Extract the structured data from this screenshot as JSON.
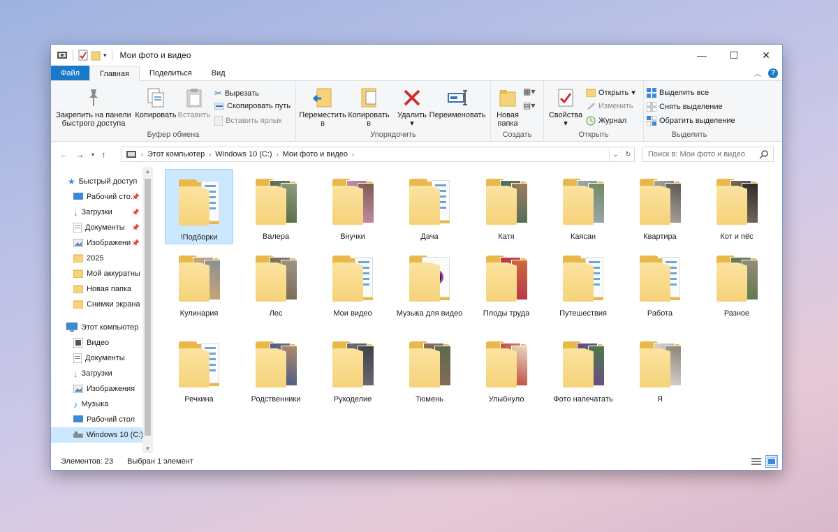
{
  "window": {
    "title": "Мои фото и видео",
    "controls": {
      "minimize": "—",
      "maximize": "☐",
      "close": "✕"
    }
  },
  "tabs": [
    "Файл",
    "Главная",
    "Поделиться",
    "Вид"
  ],
  "ribbon": {
    "clipboard": {
      "label": "Буфер обмена",
      "pin": "Закрепить на панели быстрого доступа",
      "pin_l1": "Закрепить на панели",
      "pin_l2": "быстрого доступа",
      "copy": "Копировать",
      "paste": "Вставить",
      "cut": "Вырезать",
      "copy_path": "Скопировать путь",
      "paste_shortcut": "Вставить ярлык"
    },
    "organize": {
      "label": "Упорядочить",
      "move_l1": "Переместить",
      "move_l2": "в",
      "copyto_l1": "Копировать",
      "copyto_l2": "в",
      "delete": "Удалить",
      "rename": "Переименовать"
    },
    "new": {
      "label": "Создать",
      "new_folder_l1": "Новая",
      "new_folder_l2": "папка"
    },
    "open": {
      "label": "Открыть",
      "properties": "Свойства",
      "open": "Открыть",
      "edit": "Изменить",
      "history": "Журнал"
    },
    "select": {
      "label": "Выделить",
      "select_all": "Выделить все",
      "select_none": "Снять выделение",
      "invert": "Обратить выделение"
    }
  },
  "address": {
    "crumbs": [
      "Этот компьютер",
      "Windows 10 (C:)",
      "Мои фото и видео"
    ],
    "search_placeholder": "Поиск в: Мои фото и видео"
  },
  "nav": {
    "quick_access": "Быстрый доступ",
    "quick_items": [
      "Рабочий сто...",
      "Загрузки",
      "Документы",
      "Изображени",
      "2025",
      "Мой аккуратны",
      "Новая папка",
      "Снимки экрана"
    ],
    "this_pc": "Этот компьютер",
    "pc_items": [
      "Видео",
      "Документы",
      "Загрузки",
      "Изображения",
      "Музыка",
      "Рабочий стол",
      "Windows 10 (C:)"
    ]
  },
  "folders": [
    {
      "name": "!Подборки",
      "kind": "paper",
      "selected": true
    },
    {
      "name": "Валера",
      "kind": "photo",
      "colors": [
        "#5a6b4a",
        "#8c9d7a"
      ]
    },
    {
      "name": "Внучки",
      "kind": "photo",
      "colors": [
        "#c98ca8",
        "#7a5b4e"
      ]
    },
    {
      "name": "Дача",
      "kind": "paper"
    },
    {
      "name": "Катя",
      "kind": "photo",
      "colors": [
        "#4d6e5a",
        "#a07b5c"
      ]
    },
    {
      "name": "Каясан",
      "kind": "photo",
      "colors": [
        "#9aa8b4",
        "#6f8a5e"
      ]
    },
    {
      "name": "Квартира",
      "kind": "photo",
      "colors": [
        "#a8a49c",
        "#5d5a56"
      ]
    },
    {
      "name": "Кот и пёс",
      "kind": "photo",
      "colors": [
        "#7a6a5a",
        "#2e2a28"
      ]
    },
    {
      "name": "Кулинария",
      "kind": "photo",
      "colors": [
        "#c9a874",
        "#8a8e94"
      ]
    },
    {
      "name": "Лес",
      "kind": "photo",
      "colors": [
        "#7a6a54",
        "#9e9484"
      ]
    },
    {
      "name": "Мои видео",
      "kind": "paper"
    },
    {
      "name": "Музыка для видео",
      "kind": "music"
    },
    {
      "name": "Плоды труда",
      "kind": "photo",
      "colors": [
        "#b8344a",
        "#d06a3a"
      ]
    },
    {
      "name": "Путешествия",
      "kind": "paper"
    },
    {
      "name": "Работа",
      "kind": "paper"
    },
    {
      "name": "Разное",
      "kind": "photo",
      "colors": [
        "#5a7a4e",
        "#9a8a7a"
      ]
    },
    {
      "name": "Речкина",
      "kind": "paper"
    },
    {
      "name": "Родственники",
      "kind": "photo",
      "colors": [
        "#4a5a8a",
        "#b08a6a"
      ]
    },
    {
      "name": "Рукоделие",
      "kind": "photo",
      "colors": [
        "#6a6e72",
        "#3e4246"
      ]
    },
    {
      "name": "Тюмень",
      "kind": "photo",
      "colors": [
        "#8a6a5a",
        "#5a6a4a"
      ]
    },
    {
      "name": "Улыбнуло",
      "kind": "photo",
      "colors": [
        "#c04a3e",
        "#e8d6c0"
      ]
    },
    {
      "name": "Фото напечатать",
      "kind": "photo",
      "colors": [
        "#6a4a8a",
        "#4e7a4a"
      ]
    },
    {
      "name": "Я",
      "kind": "photo",
      "colors": [
        "#d8d4cc",
        "#8a847a"
      ]
    }
  ],
  "status": {
    "items": "Элементов: 23",
    "selected": "Выбран 1 элемент"
  },
  "colors": {
    "file_tab": "#1979ca",
    "selection": "#cce8ff",
    "folder": "#f6d27a"
  }
}
